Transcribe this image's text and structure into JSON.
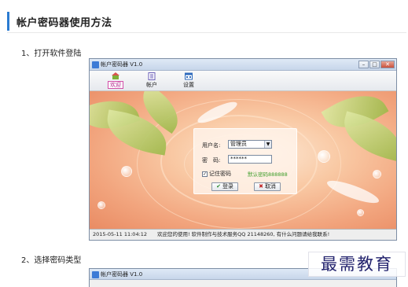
{
  "article": {
    "title": "帐户密码器使用方法",
    "steps": [
      {
        "label": "1、打开软件登陆"
      },
      {
        "label": "2、选择密码类型"
      }
    ]
  },
  "app": {
    "title": "帐户密码器 V1.0",
    "window_buttons": {
      "minimize": "–",
      "maximize": "□",
      "close": "✕"
    },
    "toolbar": [
      {
        "label": "欢迎",
        "icon": "home-icon",
        "active": true
      },
      {
        "label": "帐户",
        "icon": "account-icon",
        "active": false
      },
      {
        "label": "设置",
        "icon": "settings-icon",
        "active": false
      }
    ],
    "login": {
      "username_label": "用户名:",
      "username_value": "管理员",
      "password_label": "密　码:",
      "password_value": "******",
      "remember_label": "记住密码",
      "remember_checked": true,
      "default_password_hint": "默认密码888888",
      "login_button": "登录",
      "cancel_button": "取消"
    },
    "status": {
      "time": "2015-05-11  11:04:12",
      "message": "欢迎您的使用! 软件制作与技术服务QQ 21148260, 有什么问题请给我联系!"
    },
    "second_window_title": "帐户密码器 V1.0"
  },
  "watermark": {
    "text": "最需教育"
  },
  "colors": {
    "accent": "#2b7bd1",
    "active_tab": "#d24fa8",
    "hint_green": "#3c9d2a",
    "watermark": "#23236e"
  }
}
